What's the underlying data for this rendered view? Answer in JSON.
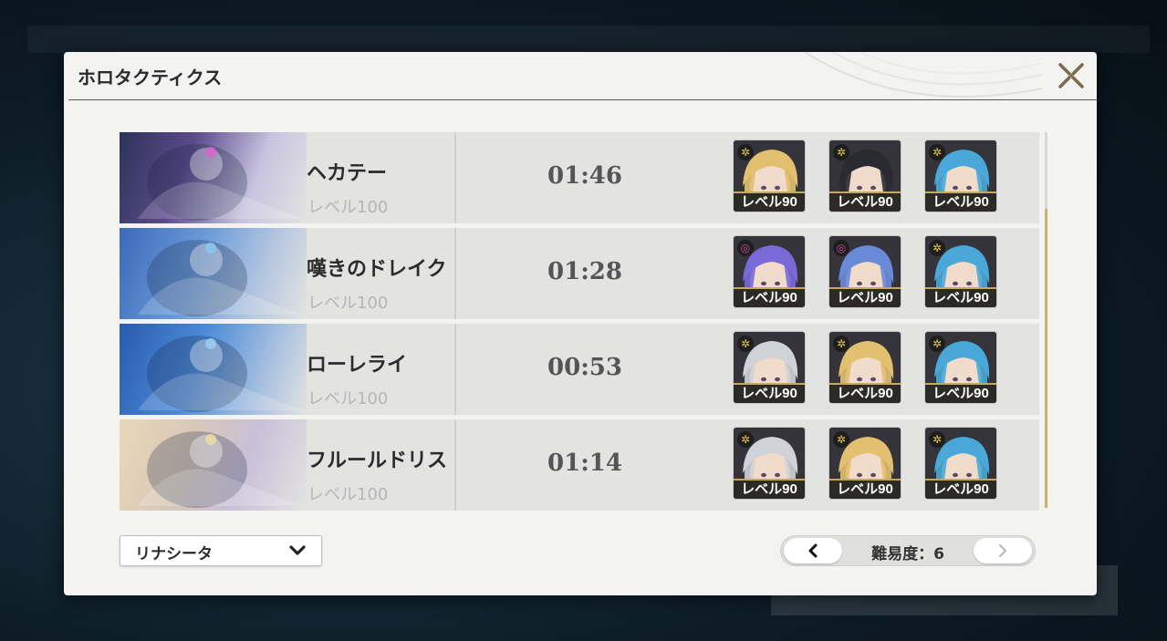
{
  "modal": {
    "title": "ホロタクティクス"
  },
  "records": [
    {
      "boss": "ヘカテー",
      "level": "レベル100",
      "time": "01:46",
      "team": [
        {
          "level": "レベル90",
          "element": "spectro",
          "hair": "#e2c070"
        },
        {
          "level": "レベル90",
          "element": "spectro",
          "hair": "#2a2a33"
        },
        {
          "level": "レベル90",
          "element": "spectro",
          "hair": "#4aa8d8"
        }
      ]
    },
    {
      "boss": "嘆きのドレイク",
      "level": "レベル100",
      "time": "01:28",
      "team": [
        {
          "level": "レベル90",
          "element": "havoc",
          "hair": "#7a6ad8"
        },
        {
          "level": "レベル90",
          "element": "havoc",
          "hair": "#6a8ad8"
        },
        {
          "level": "レベル90",
          "element": "spectro",
          "hair": "#4aa8d8"
        }
      ]
    },
    {
      "boss": "ローレライ",
      "level": "レベル100",
      "time": "00:53",
      "team": [
        {
          "level": "レベル90",
          "element": "spectro",
          "hair": "#cfd2d8"
        },
        {
          "level": "レベル90",
          "element": "spectro",
          "hair": "#e2c070"
        },
        {
          "level": "レベル90",
          "element": "spectro",
          "hair": "#4aa8d8"
        }
      ]
    },
    {
      "boss": "フルールドリス",
      "level": "レベル100",
      "time": "01:14",
      "team": [
        {
          "level": "レベル90",
          "element": "spectro",
          "hair": "#cfd2d8"
        },
        {
          "level": "レベル90",
          "element": "spectro",
          "hair": "#e2c070"
        },
        {
          "level": "レベル90",
          "element": "spectro",
          "hair": "#4aa8d8"
        }
      ]
    }
  ],
  "filter": {
    "selected": "リナシータ"
  },
  "pager": {
    "label": "難易度：6",
    "prev_icon": "chevron-left-icon",
    "next_icon": "chevron-right-icon",
    "next_disabled": true
  },
  "colors": {
    "accent_gold": "#c8a85a",
    "spectro": "#e8c84a",
    "havoc": "#d44a9a"
  }
}
